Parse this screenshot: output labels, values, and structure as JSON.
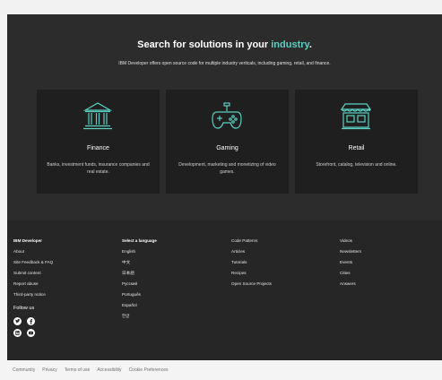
{
  "hero": {
    "title_prefix": "Search for solutions in your ",
    "title_accent": "industry",
    "title_suffix": ".",
    "subtitle": "IBM Developer offers open source code for multiple industry verticals, including gaming, retail, and finance.",
    "accent_color": "#5ad0c3"
  },
  "cards": [
    {
      "icon": "bank-icon",
      "name": "Finance",
      "desc": "Banks, investment funds, insurance companies and real estate."
    },
    {
      "icon": "game-controller-icon",
      "name": "Gaming",
      "desc": "Development, marketing and monetizing of video games."
    },
    {
      "icon": "storefront-icon",
      "name": "Retail",
      "desc": "Storefront, catalog, television and online."
    }
  ],
  "footer": {
    "col1": {
      "brand_prefix": "IBM ",
      "brand_bold": "Developer",
      "items": [
        "About",
        "Site Feedback & FAQ",
        "Submit content",
        "Report abuse",
        "Third-party notice"
      ],
      "follow_label": "Follow us",
      "social_icons": [
        "twitter-icon",
        "facebook-icon",
        "linkedin-icon",
        "youtube-icon"
      ]
    },
    "col2": {
      "heading": "Select a language",
      "items": [
        "English",
        "中文",
        "日本語",
        "Русский",
        "Português",
        "Español",
        "한글"
      ]
    },
    "col3": {
      "items": [
        "Code Patterns",
        "Articles",
        "Tutorials",
        "Recipes",
        "Open Source Projects"
      ]
    },
    "col4": {
      "items": [
        "Videos",
        "Newsletters",
        "Events",
        "Cities",
        "Answers"
      ]
    }
  },
  "bottom_links": [
    "Community",
    "Privacy",
    "Terms of use",
    "Accessibility",
    "Cookie Preferences"
  ]
}
